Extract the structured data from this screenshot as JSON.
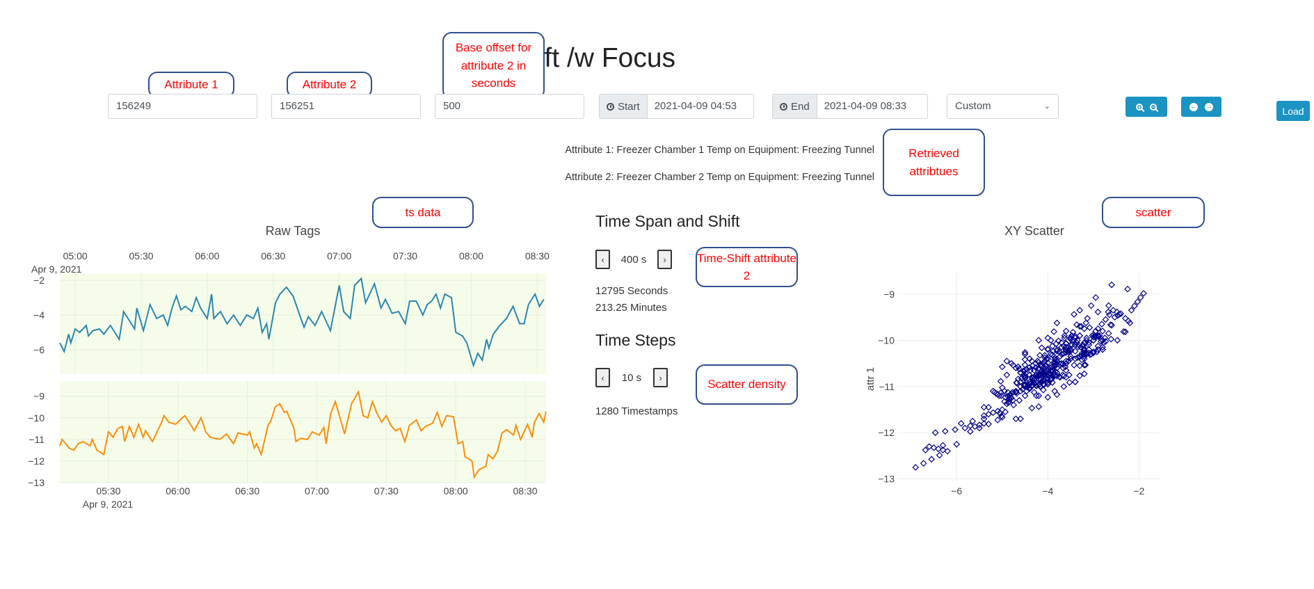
{
  "title": "TimeShift /w Focus",
  "inputs": {
    "attribute1": "156249",
    "attribute2": "156251",
    "offset": "500"
  },
  "start": {
    "label": "Start",
    "value": "2021-04-09 04:53",
    "icon": "clock-icon"
  },
  "end": {
    "label": "End",
    "value": "2021-04-09 08:33",
    "icon": "clock-icon"
  },
  "range_select": {
    "value": "Custom"
  },
  "buttons": {
    "zoom_in": "zoom-in-icon",
    "zoom_out": "zoom-out-icon",
    "back": "arrow-left-icon",
    "forward": "arrow-right-icon",
    "load": "Load",
    "color": "#1b93c3"
  },
  "attributes": {
    "line1": "Attribute 1: Freezer Chamber 1 Temp on Equipment: Freezing Tunnel",
    "line2": "Attribute 2: Freezer Chamber 2 Temp on Equipment: Freezing Tunnel"
  },
  "annotations": {
    "attr1": "Attribute 1",
    "attr2": "Attribute 2",
    "offset": "Base offset for attribute 2 in seconds",
    "retrieved": "Retrieved attribtues",
    "tsdata": "ts data",
    "timeshift": "Time-Shift attribute 2",
    "density": "Scatter density",
    "scatter": "scatter"
  },
  "span": {
    "heading": "Time Span and Shift",
    "shift_value": "400 s",
    "seconds": "12795 Seconds",
    "minutes": "213.25 Minutes",
    "prev": "‹",
    "next": "›"
  },
  "steps": {
    "heading": "Time Steps",
    "value": "10 s",
    "timestamps": "1280 Timestamps",
    "prev": "‹",
    "next": "›"
  },
  "chart_data": [
    {
      "type": "line",
      "title": "Raw Tags",
      "grid": true,
      "background": "#f5fdea",
      "date": "Apr 9, 2021",
      "subplots": [
        {
          "name": "",
          "color": "#2a86ad",
          "xaxis_position": "top",
          "xlim": [
            "04:53",
            "08:34"
          ],
          "xticks": [
            "05:00",
            "05:30",
            "06:00",
            "06:30",
            "07:00",
            "07:30",
            "08:00",
            "08:30"
          ],
          "ylim": [
            -7.4,
            -1.6
          ],
          "yticks": [
            -2,
            -4,
            -6
          ],
          "x": [
            "04:53",
            "04:55",
            "04:57",
            "04:58",
            "05:00",
            "05:02",
            "05:05",
            "05:06",
            "05:08",
            "05:11",
            "05:13",
            "05:16",
            "05:18",
            "05:20",
            "05:22",
            "05:25",
            "05:27",
            "05:28",
            "05:31",
            "05:34",
            "05:37",
            "05:40",
            "05:42",
            "05:44",
            "05:46",
            "05:48",
            "05:50",
            "05:53",
            "05:55",
            "05:57",
            "06:00",
            "06:02",
            "06:03",
            "06:06",
            "06:09",
            "06:12",
            "06:15",
            "06:18",
            "06:21",
            "06:23",
            "06:25",
            "06:27",
            "06:28",
            "06:31",
            "06:33",
            "06:36",
            "06:39",
            "06:42",
            "06:44",
            "06:46",
            "06:49",
            "06:52",
            "06:56",
            "07:00",
            "07:02",
            "07:05",
            "07:07",
            "07:10",
            "07:12",
            "07:16",
            "07:19",
            "07:21",
            "07:24",
            "07:27",
            "07:30",
            "07:32",
            "07:35",
            "07:38",
            "07:40",
            "07:42",
            "07:44",
            "07:46",
            "07:48",
            "07:51",
            "07:53",
            "07:56",
            "07:58",
            "08:01",
            "08:03",
            "08:05",
            "08:07",
            "08:08",
            "08:10",
            "08:13",
            "08:16",
            "08:19",
            "08:22",
            "08:24",
            "08:26",
            "08:29",
            "08:31",
            "08:33"
          ],
          "y": [
            -5.6,
            -6.1,
            -5.1,
            -5.6,
            -4.8,
            -5.0,
            -4.6,
            -5.2,
            -4.9,
            -4.8,
            -5.1,
            -4.6,
            -5.0,
            -5.4,
            -3.8,
            -4.4,
            -4.8,
            -3.6,
            -4.9,
            -3.4,
            -4.2,
            -4.0,
            -4.6,
            -3.6,
            -2.9,
            -3.7,
            -3.5,
            -3.8,
            -3.0,
            -3.6,
            -4.2,
            -2.8,
            -4.2,
            -3.8,
            -4.5,
            -4.0,
            -4.6,
            -4.0,
            -4.2,
            -3.6,
            -5.0,
            -4.5,
            -5.4,
            -3.3,
            -2.8,
            -2.4,
            -2.9,
            -4.0,
            -4.7,
            -4.1,
            -4.6,
            -3.8,
            -4.9,
            -2.3,
            -3.8,
            -4.2,
            -2.3,
            -1.9,
            -3.3,
            -2.2,
            -3.6,
            -3.1,
            -3.9,
            -3.8,
            -4.5,
            -3.2,
            -3.2,
            -4.0,
            -3.4,
            -3.2,
            -2.8,
            -3.6,
            -2.8,
            -3.0,
            -5.0,
            -5.2,
            -5.6,
            -6.9,
            -6.2,
            -6.6,
            -5.4,
            -5.9,
            -5.1,
            -4.6,
            -4.2,
            -3.5,
            -4.5,
            -4.5,
            -3.4,
            -2.8,
            -3.5,
            -3.1
          ]
        },
        {
          "name": "",
          "color": "#ff8c0a",
          "xaxis_position": "bottom",
          "xlim": [
            "05:09",
            "08:39"
          ],
          "xticks": [
            "05:30",
            "06:00",
            "06:30",
            "07:00",
            "07:30",
            "08:00",
            "08:30"
          ],
          "ylim": [
            -13,
            -8.3
          ],
          "yticks": [
            -9,
            -10,
            -11,
            -12,
            -13
          ],
          "x": [
            "05:09",
            "05:10",
            "05:13",
            "05:15",
            "05:17",
            "05:19",
            "05:22",
            "05:23",
            "05:25",
            "05:28",
            "05:30",
            "05:32",
            "05:34",
            "05:36",
            "05:37",
            "05:39",
            "05:41",
            "05:43",
            "05:45",
            "05:46",
            "05:49",
            "05:53",
            "05:54",
            "05:56",
            "05:59",
            "06:01",
            "06:03",
            "06:06",
            "06:07",
            "06:10",
            "06:12",
            "06:14",
            "06:18",
            "06:21",
            "06:24",
            "06:26",
            "06:30",
            "06:31",
            "06:33",
            "06:34",
            "06:36",
            "06:39",
            "06:40",
            "06:42",
            "06:44",
            "06:46",
            "06:47",
            "06:50",
            "06:51",
            "06:53",
            "06:56",
            "06:58",
            "07:01",
            "07:03",
            "07:04",
            "07:06",
            "07:08",
            "07:10",
            "07:12",
            "07:15",
            "07:18",
            "07:20",
            "07:22",
            "07:24",
            "07:26",
            "07:28",
            "07:30",
            "07:32",
            "07:34",
            "07:36",
            "07:38",
            "07:40",
            "07:43",
            "07:45",
            "07:47",
            "07:50",
            "07:52",
            "07:54",
            "07:56",
            "07:59",
            "08:01",
            "08:03",
            "08:04",
            "08:07",
            "08:08",
            "08:10",
            "08:13",
            "08:14",
            "08:16",
            "08:18",
            "08:20",
            "08:22",
            "08:25",
            "08:26",
            "08:28",
            "08:31",
            "08:33",
            "08:34",
            "08:36",
            "08:38",
            "08:39"
          ],
          "y": [
            -11.3,
            -11.0,
            -11.4,
            -11.5,
            -11.2,
            -11.1,
            -11.3,
            -11.0,
            -11.5,
            -11.7,
            -10.65,
            -10.9,
            -10.5,
            -10.4,
            -11.1,
            -10.4,
            -10.9,
            -10.3,
            -10.9,
            -10.6,
            -11.1,
            -10.2,
            -9.9,
            -10.2,
            -10.3,
            -10.1,
            -9.9,
            -10.4,
            -10.6,
            -10.0,
            -10.65,
            -10.9,
            -11.0,
            -10.75,
            -11.2,
            -10.7,
            -10.8,
            -10.65,
            -11.4,
            -11.2,
            -11.7,
            -10.3,
            -10.2,
            -9.5,
            -9.35,
            -9.75,
            -9.7,
            -10.45,
            -11.1,
            -10.95,
            -11.0,
            -10.65,
            -10.8,
            -10.45,
            -11.2,
            -9.8,
            -9.25,
            -10.0,
            -10.75,
            -9.35,
            -8.8,
            -9.9,
            -10.0,
            -9.25,
            -9.8,
            -10.2,
            -9.9,
            -10.35,
            -10.6,
            -10.5,
            -11.1,
            -10.35,
            -10.1,
            -10.6,
            -10.4,
            -10.25,
            -9.75,
            -10.4,
            -9.9,
            -9.95,
            -11.2,
            -11.1,
            -11.8,
            -12.0,
            -12.75,
            -12.4,
            -12.25,
            -11.7,
            -11.9,
            -11.55,
            -10.7,
            -10.55,
            -10.8,
            -10.35,
            -11.0,
            -10.3,
            -10.9,
            -10.2,
            -9.8,
            -10.2,
            -9.7
          ]
        }
      ]
    },
    {
      "type": "scatter",
      "title": "XY Scatter",
      "ylabel": "attr 1",
      "xlabel": "",
      "marker": "open-diamond",
      "color": "#00008b",
      "grid": true,
      "xlim": [
        -7.3,
        -1.55
      ],
      "ylim": [
        -13.05,
        -8.55
      ],
      "xticks": [
        -6,
        -4,
        -2
      ],
      "yticks": [
        -9,
        -10,
        -11,
        -12,
        -13
      ]
    }
  ]
}
